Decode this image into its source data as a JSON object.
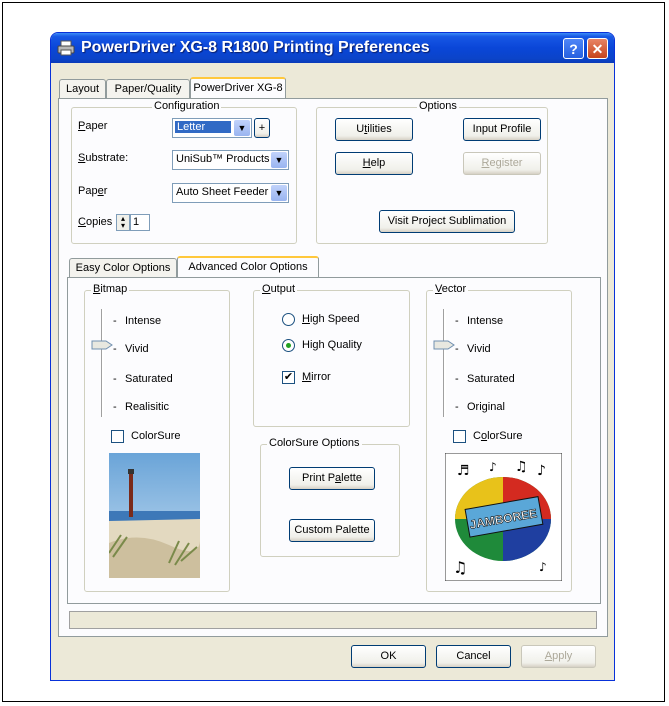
{
  "window": {
    "title": "PowerDriver XG-8 R1800 Printing Preferences",
    "help_btn": "?",
    "close_btn": "✕"
  },
  "tabs": [
    "Layout",
    "Paper/Quality",
    "PowerDriver XG-8"
  ],
  "configuration": {
    "label": "Configuration",
    "paper_label": "Paper",
    "paper_value": "Letter",
    "plus": "+",
    "substrate_label": "Substrate:",
    "substrate_value": "UniSub™ Products",
    "paper2_label": "Paper",
    "paper2_value": "Auto Sheet Feeder",
    "copies_label": "Copies",
    "copies_value": "1"
  },
  "options": {
    "label": "Options",
    "utilities": "Utilities",
    "input_profile": "Input Profile",
    "help": "Help",
    "register": "Register",
    "visit": "Visit Project Sublimation"
  },
  "subtabs": [
    "Easy Color Options",
    "Advanced Color Options"
  ],
  "bitmap": {
    "label": "Bitmap",
    "levels": [
      "Intense",
      "Vivid",
      "Saturated",
      "Realisitic"
    ],
    "selected": "Vivid",
    "colorsure": "ColorSure"
  },
  "output": {
    "label": "Output",
    "high_speed": "High Speed",
    "high_quality": "High Quality",
    "selected": "High Quality",
    "mirror": "Mirror",
    "mirror_checked": true
  },
  "colorsure_options": {
    "label": "ColorSure Options",
    "print_palette": "Print Palette",
    "custom_palette": "Custom Palette"
  },
  "vector": {
    "label": "Vector",
    "levels": [
      "Intense",
      "Vivid",
      "Saturated",
      "Original"
    ],
    "selected": "Vivid",
    "colorsure": "ColorSure"
  },
  "jamboree_logo_text": "JAMBOREE",
  "bottom": {
    "ok": "OK",
    "cancel": "Cancel",
    "apply": "Apply"
  }
}
